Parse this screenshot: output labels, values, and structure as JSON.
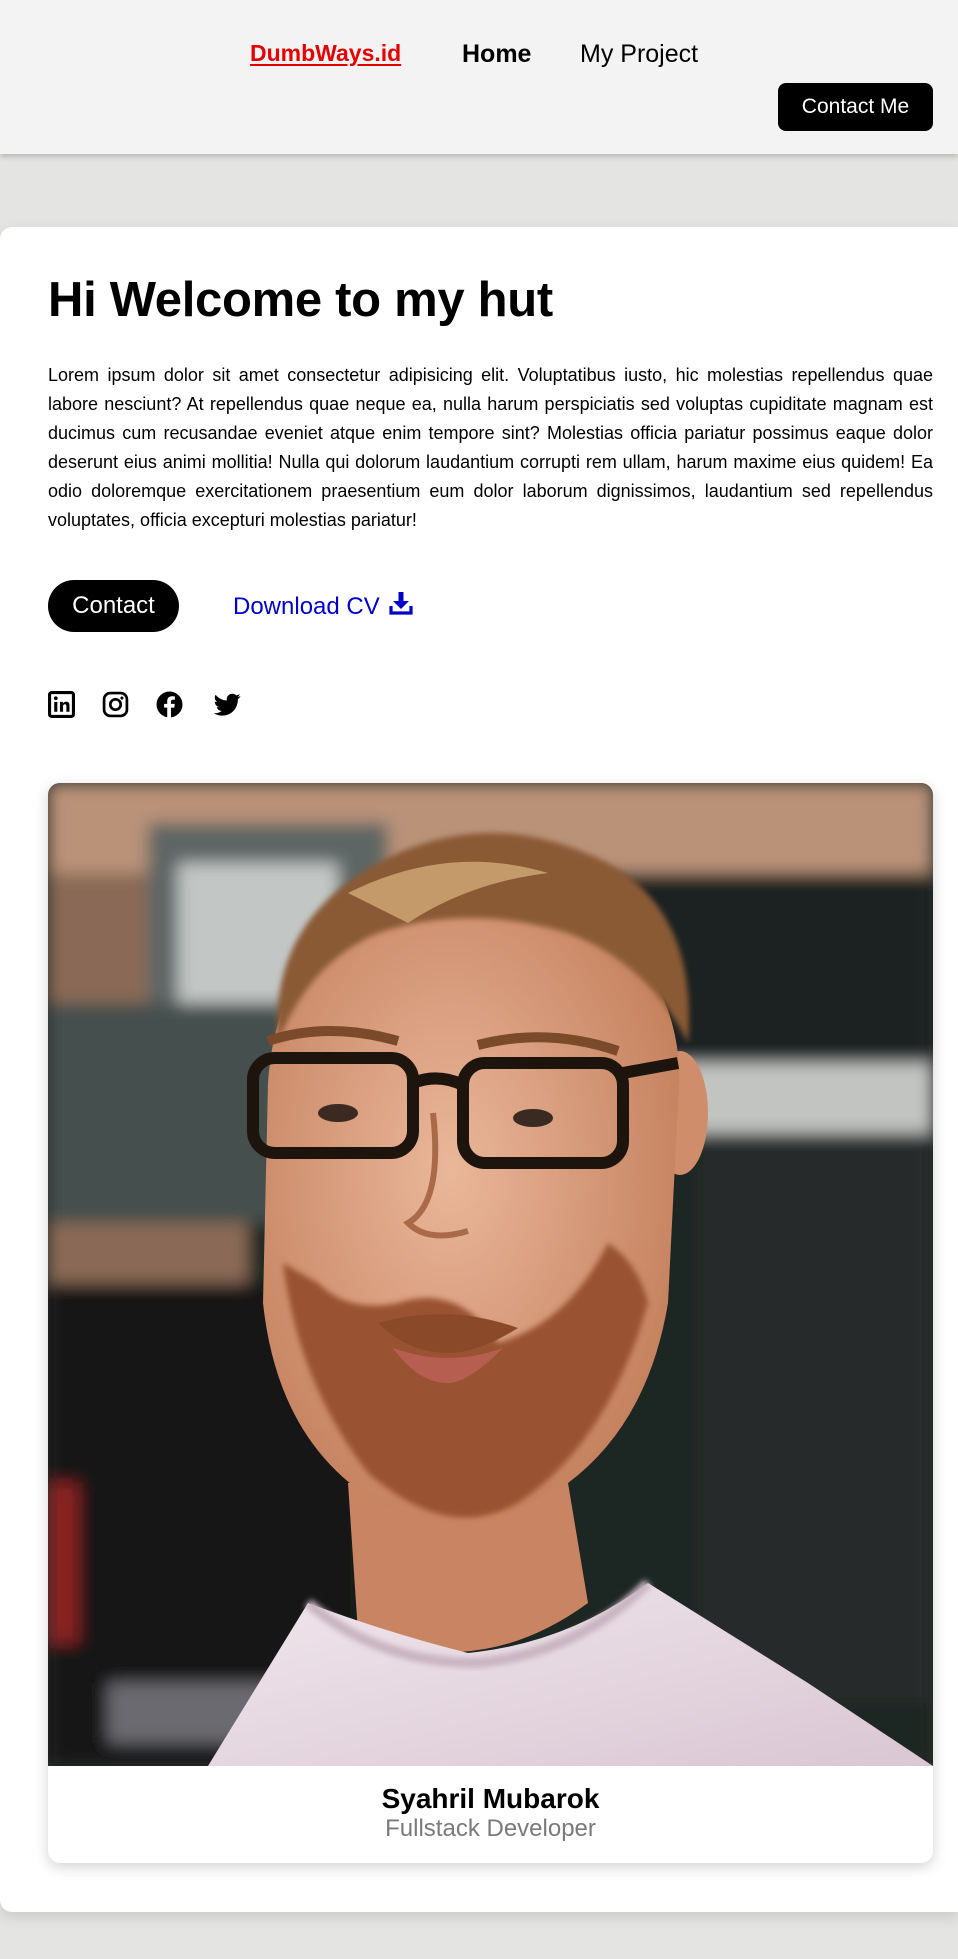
{
  "navbar": {
    "brand": "DumbWays.id",
    "links": [
      "Home",
      "My Project"
    ],
    "cta": "Contact Me"
  },
  "hero": {
    "title": "Hi Welcome to my hut",
    "description": "Lorem ipsum dolor sit amet consectetur adipisicing elit. Voluptatibus iusto, hic molestias repellendus quae labore nesciunt? At repellendus quae neque ea, nulla harum perspiciatis sed voluptas cupiditate magnam est ducimus cum recusandae eveniet atque enim tempore sint? Molestias officia pariatur possimus eaque dolor deserunt eius animi mollitia! Nulla qui dolorum laudantium corrupti rem ullam, harum maxime eius quidem! Ea odio doloremque exercitationem praesentium eum dolor laborum dignissimos, laudantium sed repellendus voluptates, officia excepturi molestias pariatur!",
    "contact_button": "Contact",
    "download_label": "Download CV"
  },
  "socials": [
    "linkedin-icon",
    "instagram-icon",
    "facebook-icon",
    "twitter-icon"
  ],
  "profile": {
    "name": "Syahril Mubarok",
    "role": "Fullstack Developer"
  },
  "colors": {
    "brand": "#e40000",
    "link": "#0000c8",
    "button": "#000000",
    "page_bg": "#e4e4e3",
    "nav_bg": "#f4f3f3"
  }
}
